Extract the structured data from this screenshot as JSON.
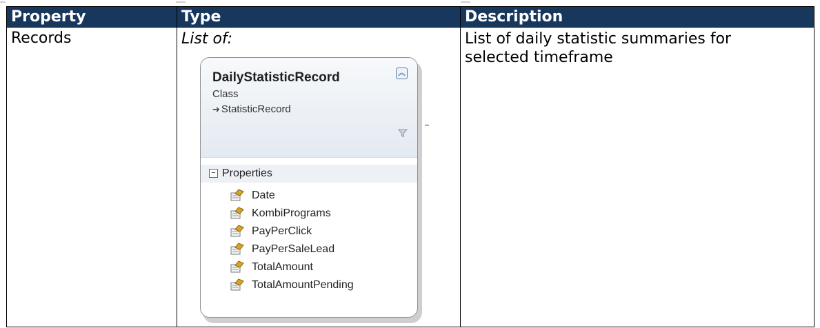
{
  "table": {
    "headers": [
      "Property",
      "Type",
      "Description"
    ],
    "row": {
      "property": "Records",
      "type_label": "List of:",
      "description": "List of daily statistic summaries for selected timeframe"
    }
  },
  "class_diagram": {
    "name": "DailyStatisticRecord",
    "kind": "Class",
    "base": "StatisticRecord",
    "section": "Properties",
    "properties": [
      "Date",
      "KombiPrograms",
      "PayPerClick",
      "PayPerSaleLead",
      "TotalAmount",
      "TotalAmountPending"
    ],
    "icons": {
      "collapse": "collapse-up-icon",
      "filter": "filter-icon",
      "property": "property-icon",
      "section_toggle": "minus-box-icon",
      "inheritance": "inheritance-arrow-icon"
    }
  },
  "colors": {
    "header_bg": "#17375d",
    "header_text": "#ffffff"
  }
}
